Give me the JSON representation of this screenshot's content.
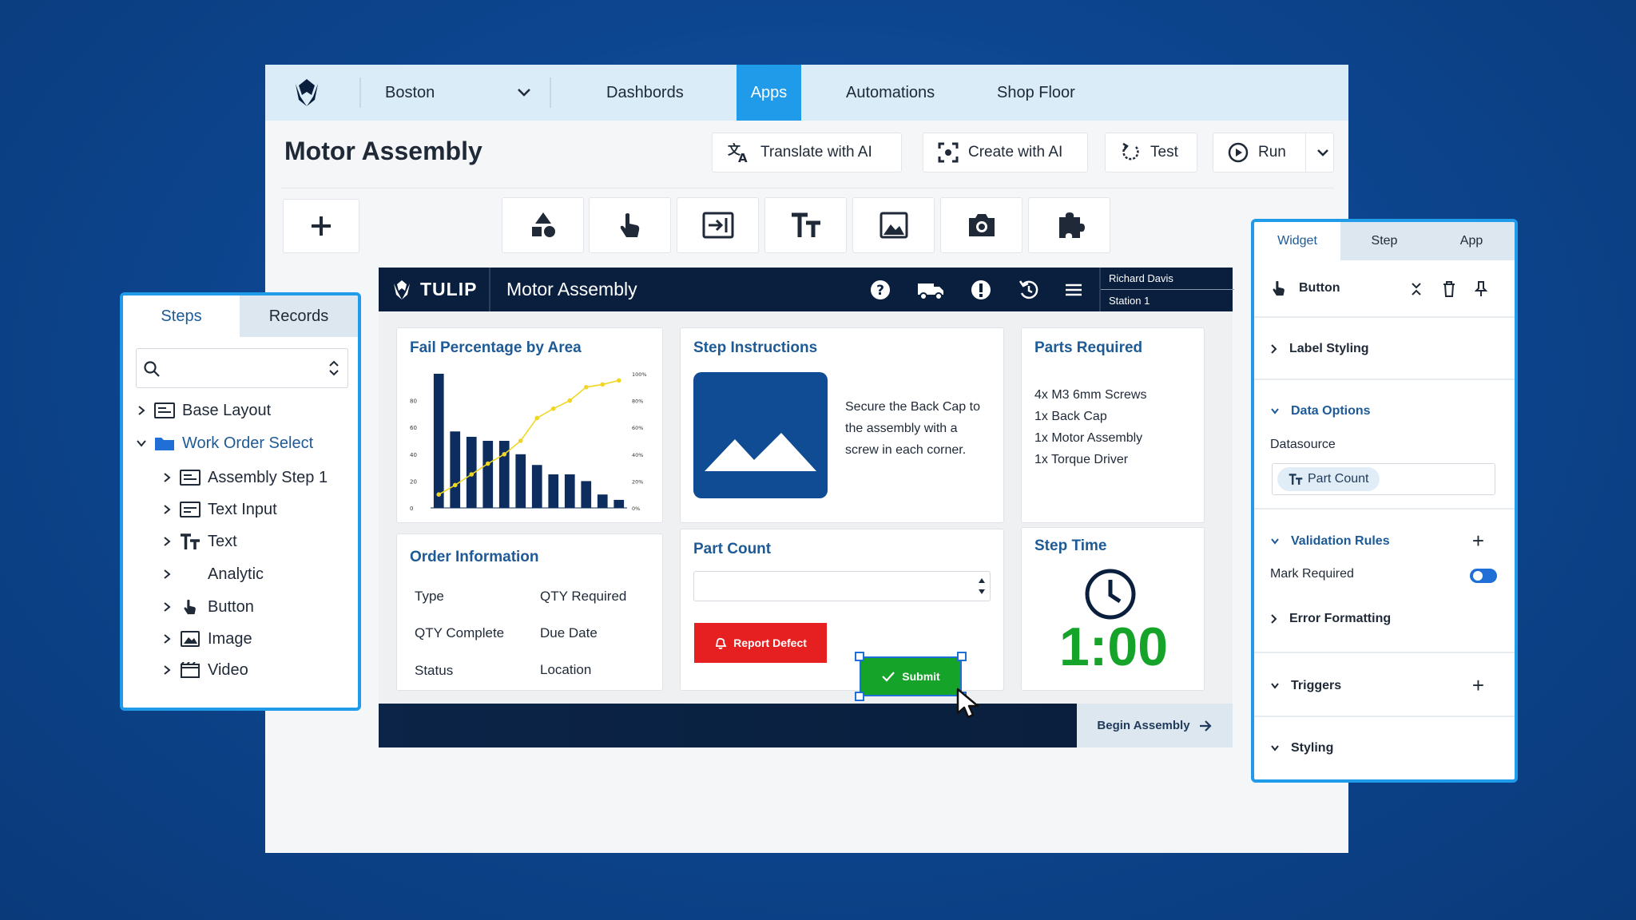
{
  "topnav": {
    "location": "Boston",
    "items": [
      "Dashbords",
      "Apps",
      "Automations",
      "Shop Floor"
    ],
    "active": "Apps"
  },
  "title": "Motor Assembly",
  "actions": {
    "translate": "Translate with AI",
    "create": "Create with AI",
    "test": "Test",
    "run": "Run"
  },
  "toolbar": {
    "tools": [
      "add-icon",
      "shapes-icon",
      "button-icon",
      "input-icon",
      "text-icon",
      "image-icon",
      "camera-icon",
      "widget-icon"
    ]
  },
  "app": {
    "brand": "TULIP",
    "title": "Motor Assembly",
    "user": "Richard Davis",
    "station": "Station 1",
    "fail_card": {
      "title": "Fail Percentage by Area"
    },
    "instructions": {
      "title": "Step Instructions",
      "text": "Secure the Back Cap to the assembly with a screw in each corner."
    },
    "parts": {
      "title": "Parts Required",
      "items": [
        "4x M3 6mm Screws",
        "1x Back Cap",
        "1x Motor Assembly",
        "1x Torque Driver"
      ]
    },
    "order": {
      "title": "Order Information",
      "fields": [
        "Type",
        "QTY Required",
        "QTY Complete",
        "Due Date",
        "Status",
        "Location"
      ]
    },
    "part_count": {
      "title": "Part Count",
      "report": "Report Defect",
      "submit": "Submit"
    },
    "step_time": {
      "title": "Step Time",
      "value": "1:00"
    },
    "begin": "Begin Assembly"
  },
  "chart_data": {
    "type": "bar",
    "title": "Fail Percentage by Area",
    "y_ticks": [
      "0",
      "20",
      "40",
      "60",
      "80"
    ],
    "y2_ticks": [
      "0%",
      "20%",
      "40%",
      "60%",
      "80%",
      "100%"
    ],
    "ylim": [
      0,
      100
    ],
    "values": [
      100,
      57,
      53,
      50,
      50,
      40,
      32,
      25,
      25,
      20,
      10,
      6
    ],
    "series": [
      {
        "values": [
          100,
          57,
          53,
          50,
          50,
          40,
          32,
          25,
          25,
          20,
          10,
          6
        ]
      },
      {
        "values": [
          10,
          17,
          25,
          33,
          40,
          50,
          67,
          74,
          80,
          90,
          92,
          95
        ]
      }
    ],
    "colors": {
      "bars": "#0d2d5e",
      "line": "#f0d622"
    }
  },
  "steps_panel": {
    "tabs": [
      "Steps",
      "Records"
    ],
    "active": "Steps",
    "tree": [
      {
        "label": "Base Layout",
        "icon": "layout-icon",
        "level": 0
      },
      {
        "label": "Work Order Select",
        "icon": "folder-icon",
        "level": 0
      },
      {
        "label": "Assembly Step 1",
        "icon": "layout-icon",
        "level": 1
      },
      {
        "label": "Text Input",
        "icon": "input-icon",
        "level": 1
      },
      {
        "label": "Text",
        "icon": "text-icon",
        "level": 1
      },
      {
        "label": "Analytic",
        "icon": "chart-icon",
        "level": 1
      },
      {
        "label": "Button",
        "icon": "button-icon",
        "level": 1
      },
      {
        "label": "Image",
        "icon": "image-icon",
        "level": 1
      },
      {
        "label": "Video",
        "icon": "video-icon",
        "level": 1
      }
    ]
  },
  "widget_panel": {
    "tabs": [
      "Widget",
      "Step",
      "App"
    ],
    "active": "Widget",
    "selected": "Button",
    "sections": {
      "label_styling": "Label Styling",
      "data_options": "Data Options",
      "datasource_label": "Datasource",
      "datasource_value": "Part Count",
      "validation": "Validation Rules",
      "mark_required": "Mark Required",
      "error_formatting": "Error Formatting",
      "triggers": "Triggers",
      "styling": "Styling"
    },
    "mark_required_on": true
  }
}
